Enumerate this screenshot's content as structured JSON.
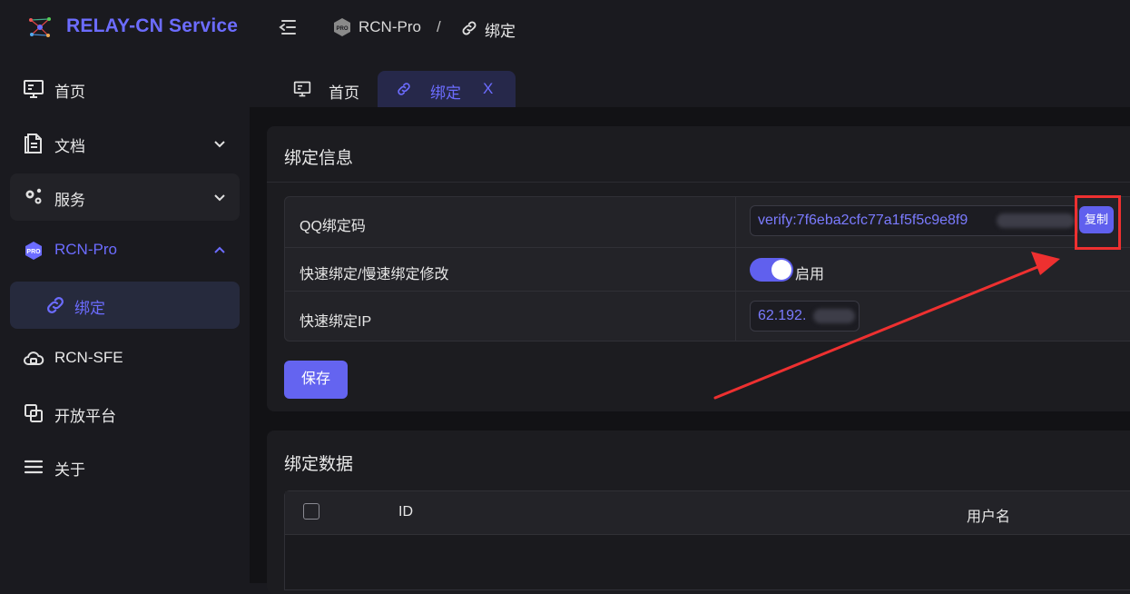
{
  "header": {
    "app_title": "RELAY-CN Service",
    "breadcrumb": [
      "RCN-Pro",
      "绑定"
    ],
    "breadcrumb_sep": "/"
  },
  "sidebar": {
    "items": [
      {
        "label": "首页",
        "icon": "monitor-icon"
      },
      {
        "label": "文档",
        "icon": "document-icon",
        "expandable": true
      },
      {
        "label": "服务",
        "icon": "gears-icon",
        "expandable": true
      },
      {
        "label": "RCN-Pro",
        "icon": "pro-badge-icon",
        "expanded": true
      },
      {
        "label": "绑定",
        "icon": "link-icon",
        "selected": true
      },
      {
        "label": "RCN-SFE",
        "icon": "cloud-icon"
      },
      {
        "label": "开放平台",
        "icon": "platform-icon"
      },
      {
        "label": "关于",
        "icon": "menu-icon"
      }
    ]
  },
  "tabs": [
    {
      "label": "首页",
      "icon": "monitor-icon"
    },
    {
      "label": "绑定",
      "icon": "link-icon",
      "active": true,
      "close": "X"
    }
  ],
  "bind_info": {
    "title": "绑定信息",
    "rows": {
      "qq_code_label": "QQ绑定码",
      "qq_code_value": "verify:7f6eba2cfc77a1f5f5c9e8f9",
      "copy_label": "复制",
      "fast_mode_label": "快速绑定/慢速绑定修改",
      "fast_mode_enabled": true,
      "fast_mode_state": "启用",
      "fast_ip_label": "快速绑定IP",
      "fast_ip_value": "62.192."
    },
    "save_label": "保存"
  },
  "bind_data": {
    "title": "绑定数据",
    "columns": [
      "ID",
      "用户名"
    ]
  },
  "colors": {
    "accent": "#6c6cff",
    "annotation": "#ee3030",
    "background": "#1a1a1f"
  }
}
